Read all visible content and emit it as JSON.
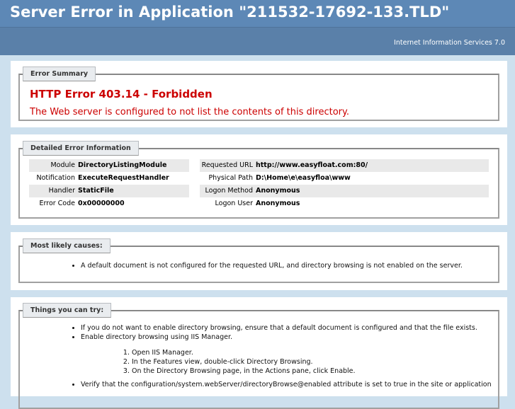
{
  "header": {
    "title": "Server Error in Application \"211532-17692-133.TLD\"",
    "subtitle": "Internet Information Services 7.0"
  },
  "summary": {
    "legend": "Error Summary",
    "title": "HTTP Error 403.14 - Forbidden",
    "message": "The Web server is configured to not list the contents of this directory."
  },
  "details": {
    "legend": "Detailed Error Information",
    "left": [
      {
        "label": "Module",
        "value": "DirectoryListingModule"
      },
      {
        "label": "Notification",
        "value": "ExecuteRequestHandler"
      },
      {
        "label": "Handler",
        "value": "StaticFile"
      },
      {
        "label": "Error Code",
        "value": "0x00000000"
      }
    ],
    "right": [
      {
        "label": "Requested URL",
        "value": "http://www.easyfloat.com:80/"
      },
      {
        "label": "Physical Path",
        "value": "D:\\Home\\e\\easyfloa\\www"
      },
      {
        "label": "Logon Method",
        "value": "Anonymous"
      },
      {
        "label": "Logon User",
        "value": "Anonymous"
      }
    ]
  },
  "causes": {
    "legend": "Most likely causes:",
    "items": [
      "A default document is not configured for the requested URL, and directory browsing is not enabled on the server."
    ]
  },
  "try": {
    "legend": "Things you can try:",
    "items": [
      "If you do not want to enable directory browsing, ensure that a default document is configured and that the file exists.",
      "Enable directory browsing using IIS Manager."
    ],
    "steps": [
      "Open IIS Manager.",
      "In the Features view, double-click Directory Browsing.",
      "On the Directory Browsing page, in the Actions pane, click Enable."
    ],
    "more": [
      "Verify that the configuration/system.webServer/directoryBrowse@enabled attribute is set to true in the site or application"
    ]
  }
}
